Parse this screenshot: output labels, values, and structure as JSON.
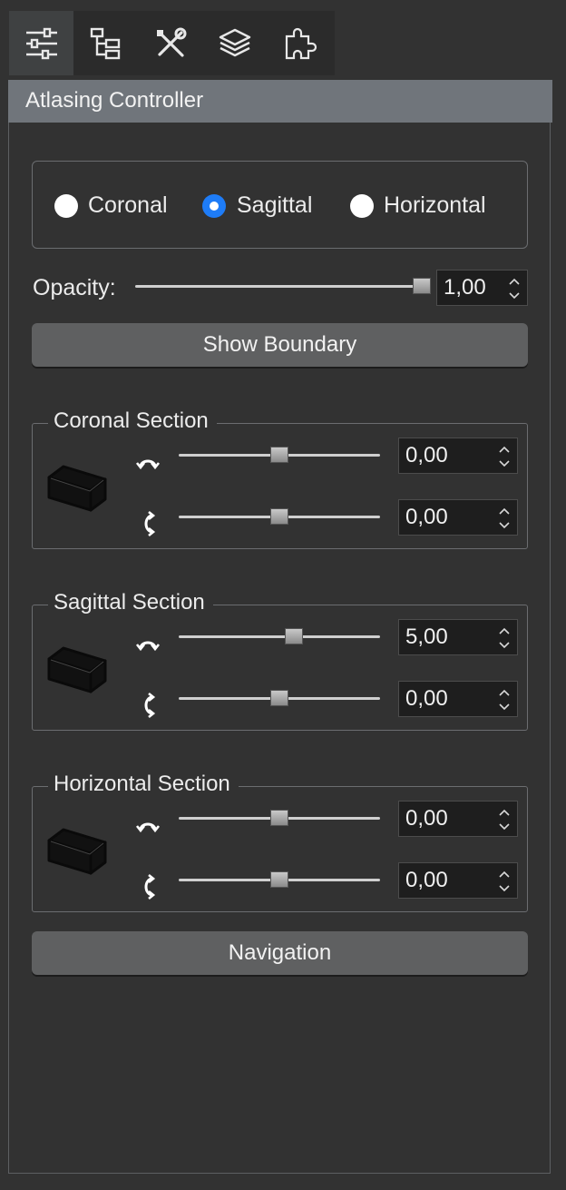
{
  "toolbar": {
    "tabs": [
      {
        "icon": "sliders-icon",
        "active": true
      },
      {
        "icon": "hierarchy-icon",
        "active": false
      },
      {
        "icon": "tools-icon",
        "active": false
      },
      {
        "icon": "layers-icon",
        "active": false
      },
      {
        "icon": "puzzle-icon",
        "active": false
      }
    ]
  },
  "panel": {
    "title": "Atlasing Controller"
  },
  "view": {
    "options": [
      "Coronal",
      "Sagittal",
      "Horizontal"
    ],
    "selected": "Sagittal"
  },
  "opacity": {
    "label": "Opacity:",
    "value": "1,00",
    "slider_fraction": 1.0
  },
  "buttons": {
    "show_boundary": "Show Boundary",
    "navigation": "Navigation"
  },
  "sections": [
    {
      "title": "Coronal Section",
      "rotation_1": "0,00",
      "rotation_2": "0,00"
    },
    {
      "title": "Sagittal Section",
      "rotation_1": "5,00",
      "rotation_2": "0,00"
    },
    {
      "title": "Horizontal Section",
      "rotation_1": "0,00",
      "rotation_2": "0,00"
    }
  ],
  "colors": {
    "accent": "#1e7cf7",
    "header": "#70757b",
    "background": "#323232"
  }
}
